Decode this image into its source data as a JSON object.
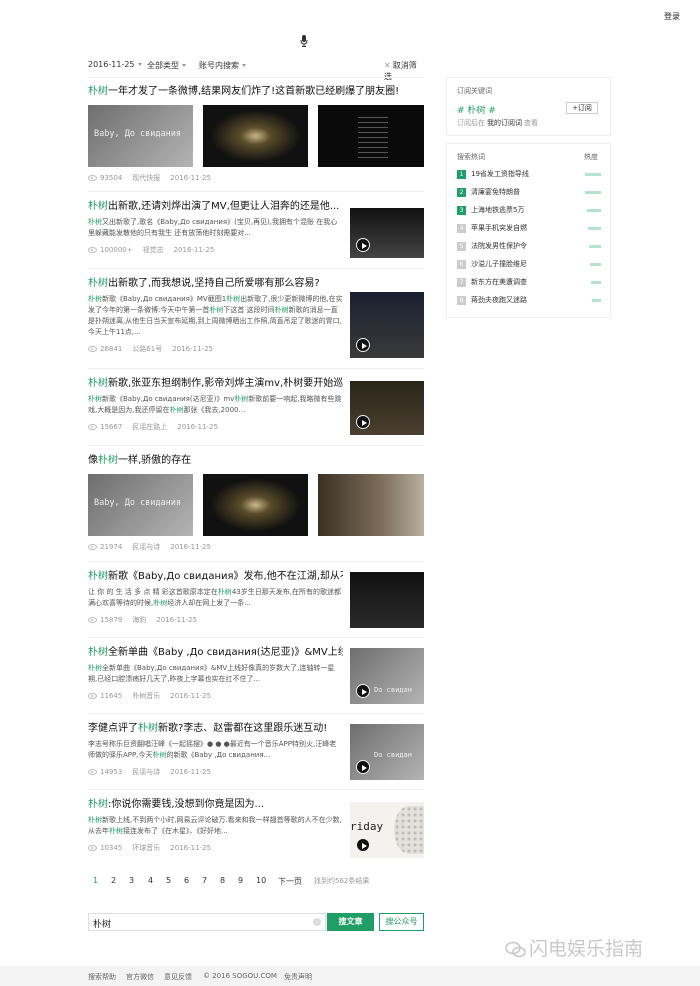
{
  "header": {
    "login": "登录"
  },
  "filters": {
    "date": "2016-11-25",
    "type": "全部类型",
    "scope": "账号内搜索",
    "cancel": "取消筛选"
  },
  "results": [
    {
      "title_pre": "",
      "hl": "朴树",
      "title_post": "一年才发了一条微博,结果网友们炸了!这首新歌已经刷爆了朋友圈!",
      "views": "93504",
      "source": "现代快报",
      "date": "2016-11-25"
    },
    {
      "title_pre": "",
      "hl": "朴树",
      "title_post": "出新歌,还请刘烨出演了MV,但更让人泪奔的还是他...",
      "summary": "朴树又出新歌了,歌名《Baby,До свидания》(宝贝,再见),我拥有个混账 在我心里躲藏能发散他的只有我生 还有放荡他时刻需要对...",
      "views": "100000+",
      "source": "视觉志",
      "date": "2016-11-25"
    },
    {
      "title_pre": "",
      "hl": "朴树",
      "title_post": "出新歌了,而我想说,坚持自己所爱哪有那么容易?",
      "summary": "朴树新歌《Baby,До свидания》MV截图1朴树出新歌了,很少更新微博的他,在实发了今年的第一条微博:今天中午第一首朴树下这首 这段时间朴树新歌的消息一直是扑朔迷离,从他生日当天宣布延期,到上周微博晒出工作照,简直吊足了歌迷的胃口,今天上午11点,...",
      "views": "26841",
      "source": "公路61号",
      "date": "2016-11-25"
    },
    {
      "title_pre": "",
      "hl": "朴树",
      "title_post": "新歌,张亚东担纲制作,影帝刘烨主演mv,朴树要开始巡...",
      "summary": "朴树新歌《Baby,До свидания(达尼亚)》mv朴树新歌前要一响起,我略微有些跳戏,大概是因为,我还停留在朴树那张《我去,2000...",
      "views": "15667",
      "source": "民谣在路上",
      "date": "2016-11-25"
    },
    {
      "title_pre": "像",
      "hl": "朴树",
      "title_post": "一样,骄傲的存在",
      "views": "21974",
      "source": "民谣与诗",
      "date": "2016-11-25"
    },
    {
      "title_pre": "",
      "hl": "朴树",
      "title_post": "新歌《Baby,До свидания》发布,他不在江湖,却从不...",
      "summary": "让 你 的 生 活 多 点 精 彩这首歌原本定在朴树43岁生日那天发布,在所有的歌迷都满心欢喜等待的时候,朴树经济人却在网上发了一条...",
      "views": "15879",
      "source": "海豹",
      "date": "2016-11-25"
    },
    {
      "title_pre": "",
      "hl": "朴树",
      "title_post": "全新单曲《Baby ,До свидания(达尼亚)》&MV上线",
      "summary": "朴树全新单曲《Baby,До свидания》&MV上线好像真的岁数大了,连轴转一星期,已经口腔溃疡好几天了,昨夜上字幕也实在扛不住了...",
      "views": "11645",
      "source": "朴树音乐",
      "date": "2016-11-25"
    },
    {
      "title_pre": "李健点评了",
      "hl": "朴树",
      "title_post": "新歌?李志、赵雷都在这里跟乐迷互动!",
      "summary": "李志号称乐巨资翻唱汪峰《一起摇摆》● ● ●最近有一个音乐APP特别火,汪峰老师做的驿乐APP,今天朴树的新歌《Baby ,До свидания...",
      "views": "14953",
      "source": "民谣与诗",
      "date": "2016-11-25"
    },
    {
      "title_pre": "",
      "hl": "朴树",
      "title_post": ":你说你需要钱,没想到你竟是因为...",
      "summary": "朴树新歌上线,不到两个小时,网易云评论破万.看来和我一样翘首等歌的人不在少数,从去年朴树接连发布了《在木星》、《好好地...",
      "views": "10345",
      "source": "环球音乐",
      "date": "2016-11-25"
    }
  ],
  "image_texts": {
    "baby": "Baby, До свидания",
    "friday": "riday",
    "thumb_text": "Do свидан"
  },
  "pager": {
    "pages": [
      "1",
      "2",
      "3",
      "4",
      "5",
      "6",
      "7",
      "8",
      "9",
      "10"
    ],
    "next": "下一页",
    "count": "找到约562条结果"
  },
  "search": {
    "value": "朴树",
    "btn_article": "搜文章",
    "btn_account": "搜公众号"
  },
  "footer": {
    "help": "搜索帮助",
    "wechat": "官方微信",
    "feedback": "意见反馈",
    "copyright": "© 2016 SOGOU.COM",
    "disclaimer": "免责声明"
  },
  "subscribe": {
    "heading": "订阅关键词",
    "keyword": "# 朴树 #",
    "button": "+订阅",
    "note_pre": "订阅后在",
    "note_link": "我的订阅词",
    "note_post": "查看"
  },
  "hot": {
    "heading": "搜索热词",
    "heat": "热度",
    "items": [
      {
        "n": "1",
        "label": "19省发工资指导线",
        "w": 0.82
      },
      {
        "n": "2",
        "label": "清廉宴免特朗普",
        "w": 0.78
      },
      {
        "n": "3",
        "label": "上海地铁逃票5万",
        "w": 0.72
      },
      {
        "n": "4",
        "label": "苹果手机突发自燃",
        "w": 0.66
      },
      {
        "n": "5",
        "label": "法院发男性保护令",
        "w": 0.6
      },
      {
        "n": "6",
        "label": "沙溢儿子撞脸维尼",
        "w": 0.55
      },
      {
        "n": "7",
        "label": "新东方在美遭调查",
        "w": 0.5
      },
      {
        "n": "8",
        "label": "蒋劲夫夜跑又迷路",
        "w": 0.45
      }
    ]
  },
  "watermark": "闪电娱乐指南",
  "colors": {
    "accent": "#1f9e65"
  }
}
